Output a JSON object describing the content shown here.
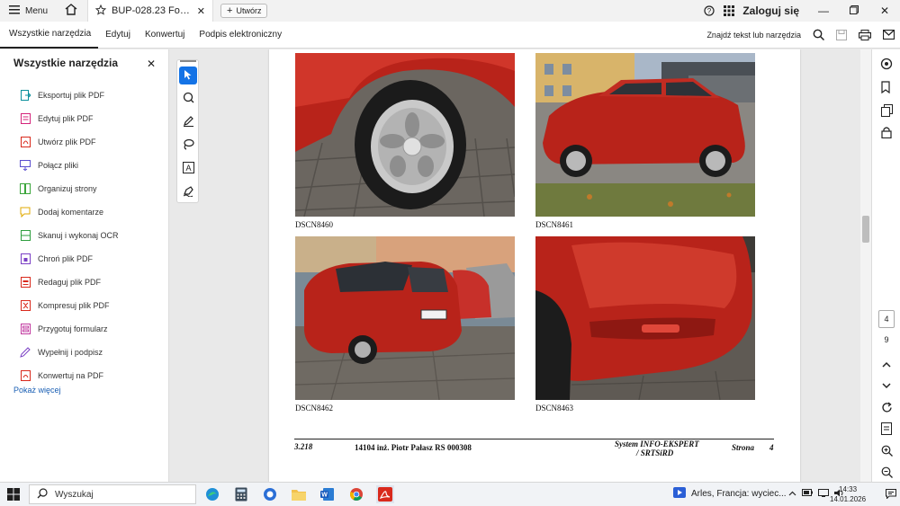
{
  "tabbar": {
    "menu_label": "Menu",
    "doc_tab_title": "BUP-028.23 Ford Fie...",
    "new_tab_label": "Utwórz",
    "signin_label": "Zaloguj się"
  },
  "toolbar": {
    "tabs": [
      "Wszystkie narzędzia",
      "Edytuj",
      "Konwertuj",
      "Podpis elektroniczny"
    ],
    "find_label": "Znajdź tekst lub narzędzia"
  },
  "left_panel": {
    "title": "Wszystkie narzędzia",
    "items": [
      {
        "label": "Eksportuj plik PDF",
        "color": "#0a8f9c"
      },
      {
        "label": "Edytuj plik PDF",
        "color": "#d4237a"
      },
      {
        "label": "Utwórz plik PDF",
        "color": "#d9291c"
      },
      {
        "label": "Połącz pliki",
        "color": "#5a4fcf"
      },
      {
        "label": "Organizuj strony",
        "color": "#3aa53a"
      },
      {
        "label": "Dodaj komentarze",
        "color": "#e0a800"
      },
      {
        "label": "Skanuj i wykonaj OCR",
        "color": "#2e9e3f"
      },
      {
        "label": "Chroń plik PDF",
        "color": "#7a3fc4"
      },
      {
        "label": "Redaguj plik PDF",
        "color": "#d9291c"
      },
      {
        "label": "Kompresuj plik PDF",
        "color": "#d9291c"
      },
      {
        "label": "Przygotuj formularz",
        "color": "#c23aa0"
      },
      {
        "label": "Wypełnij i podpisz",
        "color": "#7a3fc4"
      },
      {
        "label": "Konwertuj na PDF",
        "color": "#d9291c"
      }
    ],
    "show_more": "Pokaż więcej"
  },
  "document": {
    "captions": [
      "DSCN8460",
      "DSCN8461",
      "DSCN8462",
      "DSCN8463"
    ],
    "footer": {
      "left": "3.218",
      "author": "14104 inż. Piotr Pałasz RS 000308",
      "system_line1": "System INFO-EKSPERT",
      "system_line2": "/ SRTSiRD",
      "page_label": "Strona",
      "page_number": "4"
    }
  },
  "page_nav": {
    "current": "4",
    "total": "9"
  },
  "taskbar": {
    "search_label": "Wyszukaj",
    "weather_text": "Arles, Francja: wyciec...",
    "time": "14:33",
    "date": "14.01.2026"
  },
  "colors": {
    "accent": "#1473e6",
    "car_red": "#b8231a"
  }
}
